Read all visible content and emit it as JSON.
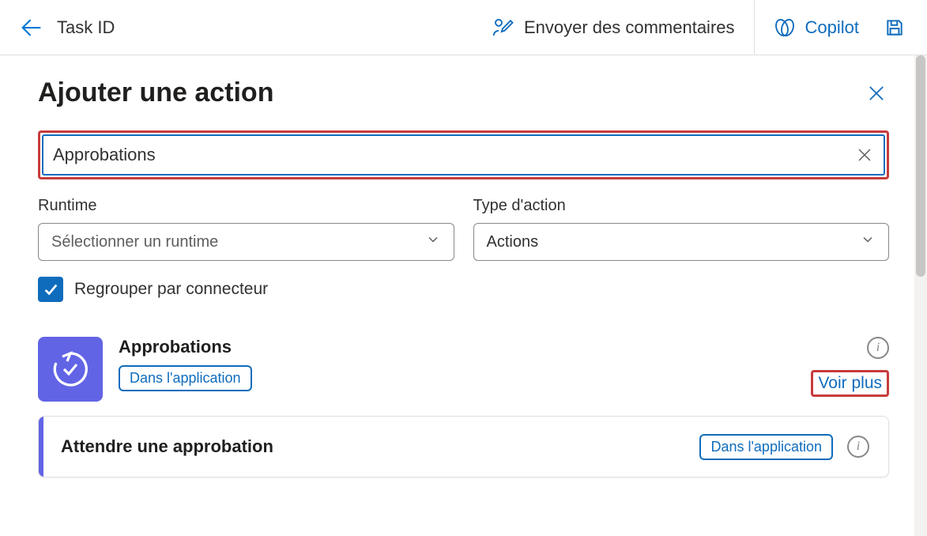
{
  "topbar": {
    "title": "Task ID",
    "feedback_label": "Envoyer des commentaires",
    "copilot_label": "Copilot"
  },
  "panel": {
    "title": "Ajouter une action"
  },
  "search": {
    "value": "Approbations"
  },
  "filters": {
    "runtime_label": "Runtime",
    "runtime_placeholder": "Sélectionner un runtime",
    "action_type_label": "Type d'action",
    "action_type_value": "Actions"
  },
  "group_checkbox": {
    "label": "Regrouper par connecteur",
    "checked": true
  },
  "connector": {
    "title": "Approbations",
    "badge": "Dans l'application",
    "see_more": "Voir plus"
  },
  "action": {
    "title": "Attendre une approbation",
    "badge": "Dans l'application"
  }
}
